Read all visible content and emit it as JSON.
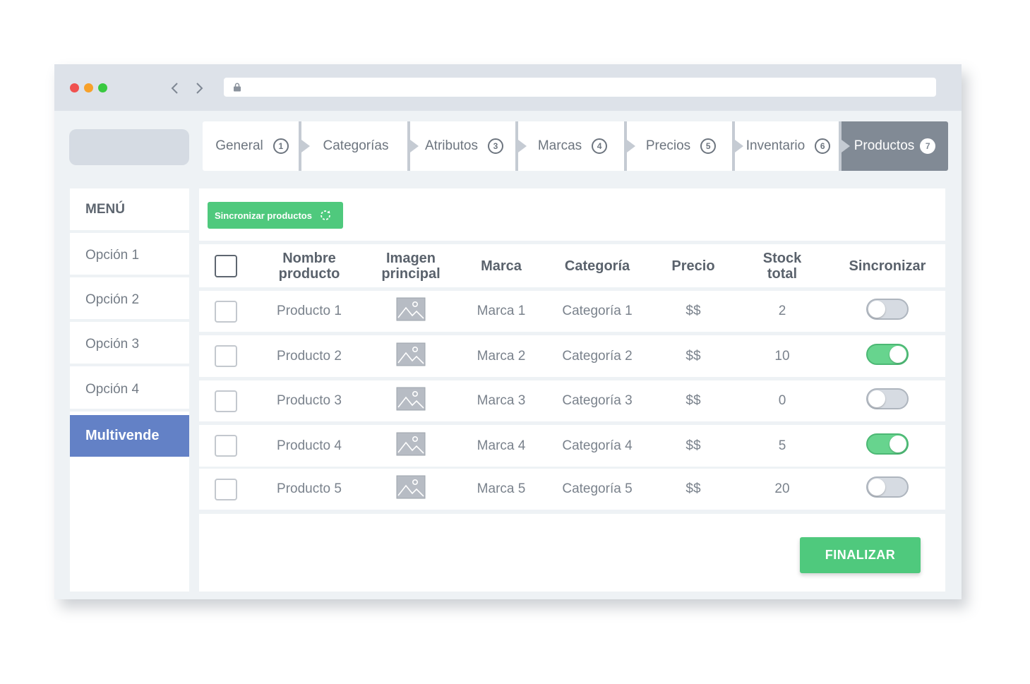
{
  "window": {
    "dots": [
      {
        "name": "close",
        "color": "#f0514f"
      },
      {
        "name": "minimize",
        "color": "#f7a12a"
      },
      {
        "name": "maximize",
        "color": "#39c940"
      }
    ],
    "url": ""
  },
  "steps": [
    {
      "label": "General",
      "num": "1",
      "active": false
    },
    {
      "label": "Categorías",
      "num": "",
      "active": false
    },
    {
      "label": "Atributos",
      "num": "3",
      "active": false
    },
    {
      "label": "Marcas",
      "num": "4",
      "active": false
    },
    {
      "label": "Precios",
      "num": "5",
      "active": false
    },
    {
      "label": "Inventario",
      "num": "6",
      "active": false
    },
    {
      "label": "Productos",
      "num": "7",
      "active": true
    }
  ],
  "sidebar": {
    "title": "MENÚ",
    "items": [
      {
        "label": "Opción 1",
        "active": false
      },
      {
        "label": "Opción 2",
        "active": false
      },
      {
        "label": "Opción 3",
        "active": false
      },
      {
        "label": "Opción 4",
        "active": false
      },
      {
        "label": "Multivende",
        "active": true
      }
    ]
  },
  "toolbar": {
    "sync_label": "Sincronizar productos"
  },
  "table": {
    "headers": {
      "name": [
        "Nombre",
        "producto"
      ],
      "image": [
        "Imagen",
        "principal"
      ],
      "brand": "Marca",
      "category": "Categoría",
      "price": "Precio",
      "stock": [
        "Stock",
        "total"
      ],
      "sync": "Sincronizar"
    },
    "rows": [
      {
        "name": "Producto 1",
        "brand": "Marca 1",
        "category": "Categoría 1",
        "price": "$$",
        "stock": "2",
        "sync": false
      },
      {
        "name": "Producto 2",
        "brand": "Marca 2",
        "category": "Categoría 2",
        "price": "$$",
        "stock": "10",
        "sync": true
      },
      {
        "name": "Producto 3",
        "brand": "Marca 3",
        "category": "Categoría 3",
        "price": "$$",
        "stock": "0",
        "sync": false
      },
      {
        "name": "Producto 4",
        "brand": "Marca 4",
        "category": "Categoría 4",
        "price": "$$",
        "stock": "5",
        "sync": true
      },
      {
        "name": "Producto 5",
        "brand": "Marca 5",
        "category": "Categoría 5",
        "price": "$$",
        "stock": "20",
        "sync": false
      }
    ]
  },
  "footer": {
    "finish_label": "FINALIZAR"
  },
  "colors": {
    "accent_green": "#4fc97d",
    "active_menu": "#6381c6",
    "active_step": "#818a95"
  }
}
